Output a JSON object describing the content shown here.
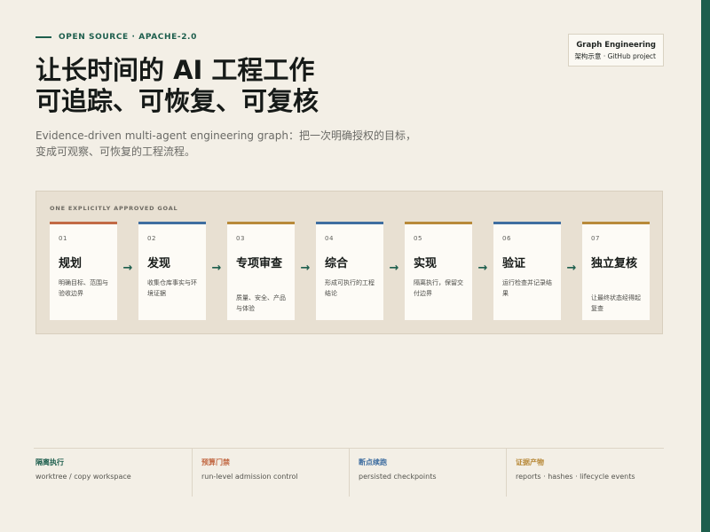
{
  "header": {
    "eyebrow": "OPEN SOURCE · APACHE-2.0",
    "title_line1": "让长时间的 AI 工程工作",
    "title_line2": "可追踪、可恢复、可复核",
    "subtitle": "Evidence-driven multi-agent engineering graph：把一次明确授权的目标，变成可观察、可恢复的工程流程。"
  },
  "badge": {
    "title": "Graph Engineering",
    "subtitle": "架构示意 · GitHub project"
  },
  "panel": {
    "label": "ONE EXPLICITLY APPROVED GOAL",
    "arrow_glyph": "→",
    "steps": [
      {
        "num": "01",
        "title": "规划",
        "desc": "明确目标、范围与验收边界",
        "color": "#c26a45"
      },
      {
        "num": "02",
        "title": "发现",
        "desc": "收集仓库事实与环境证据",
        "color": "#3f6ea0"
      },
      {
        "num": "03",
        "title": "专项审查",
        "desc": "质量、安全、产品与体验",
        "color": "#b88a3a"
      },
      {
        "num": "04",
        "title": "综合",
        "desc": "形成可执行的工程结论",
        "color": "#3f6ea0"
      },
      {
        "num": "05",
        "title": "实现",
        "desc": "隔离执行，保留交付边界",
        "color": "#b88a3a"
      },
      {
        "num": "06",
        "title": "验证",
        "desc": "运行检查并记录结果",
        "color": "#3f6ea0"
      },
      {
        "num": "07",
        "title": "独立复核",
        "desc": "让最终状态经得起复查",
        "color": "#b88a3a"
      }
    ]
  },
  "features": [
    {
      "title": "隔离执行",
      "desc": "worktree / copy workspace",
      "color": "#1d5e4d"
    },
    {
      "title": "预算门禁",
      "desc": "run-level admission control",
      "color": "#c26a45"
    },
    {
      "title": "断点续跑",
      "desc": "persisted checkpoints",
      "color": "#3f6ea0"
    },
    {
      "title": "证据产物",
      "desc": "reports · hashes · lifecycle events",
      "color": "#b88a3a"
    }
  ]
}
